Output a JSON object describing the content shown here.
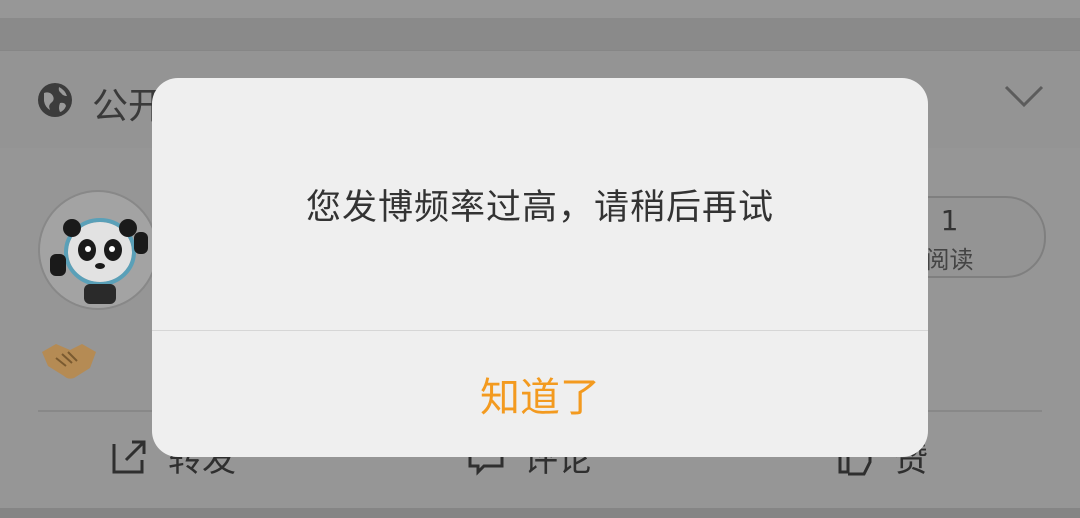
{
  "visibility": {
    "label": "公开",
    "icon": "globe-icon"
  },
  "post": {
    "read_count": "1",
    "read_label": "阅读",
    "emoji": "handshake",
    "actions": [
      {
        "label": "转发",
        "icon": "share-icon"
      },
      {
        "label": "评论",
        "icon": "comment-icon"
      },
      {
        "label": "赞",
        "icon": "like-icon"
      }
    ]
  },
  "dialog": {
    "message": "您发博频率过高，请稍后再试",
    "confirm_label": "知道了"
  },
  "colors": {
    "accent": "#f39a1f",
    "dialog_bg": "#efefef",
    "overlay": "#8f8f8f"
  }
}
